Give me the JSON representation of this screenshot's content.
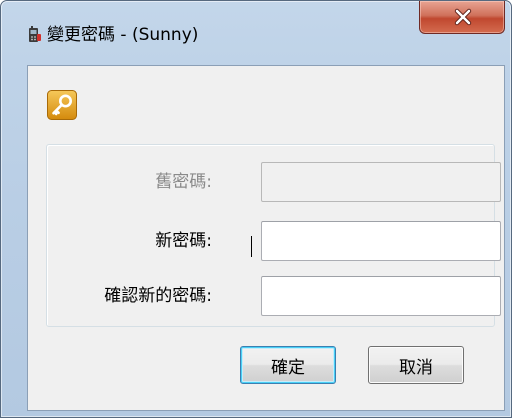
{
  "window": {
    "title": "變更密碼 - (Sunny)",
    "title_icon": "phone-icon",
    "close_icon": "close-x-icon"
  },
  "form": {
    "header_icon": "key-icon",
    "old_password": {
      "label": "舊密碼:",
      "value": "",
      "enabled": false
    },
    "new_password": {
      "label": "新密碼:",
      "value": "",
      "focused": true
    },
    "confirm_password": {
      "label": "確認新的密碼:",
      "value": ""
    }
  },
  "buttons": {
    "ok_label": "確定",
    "cancel_label": "取消"
  },
  "colors": {
    "frame": "#b9cee5",
    "close_button": "#c7503a",
    "key_icon": "#e8a317",
    "default_button_border": "#3c7fb1"
  }
}
